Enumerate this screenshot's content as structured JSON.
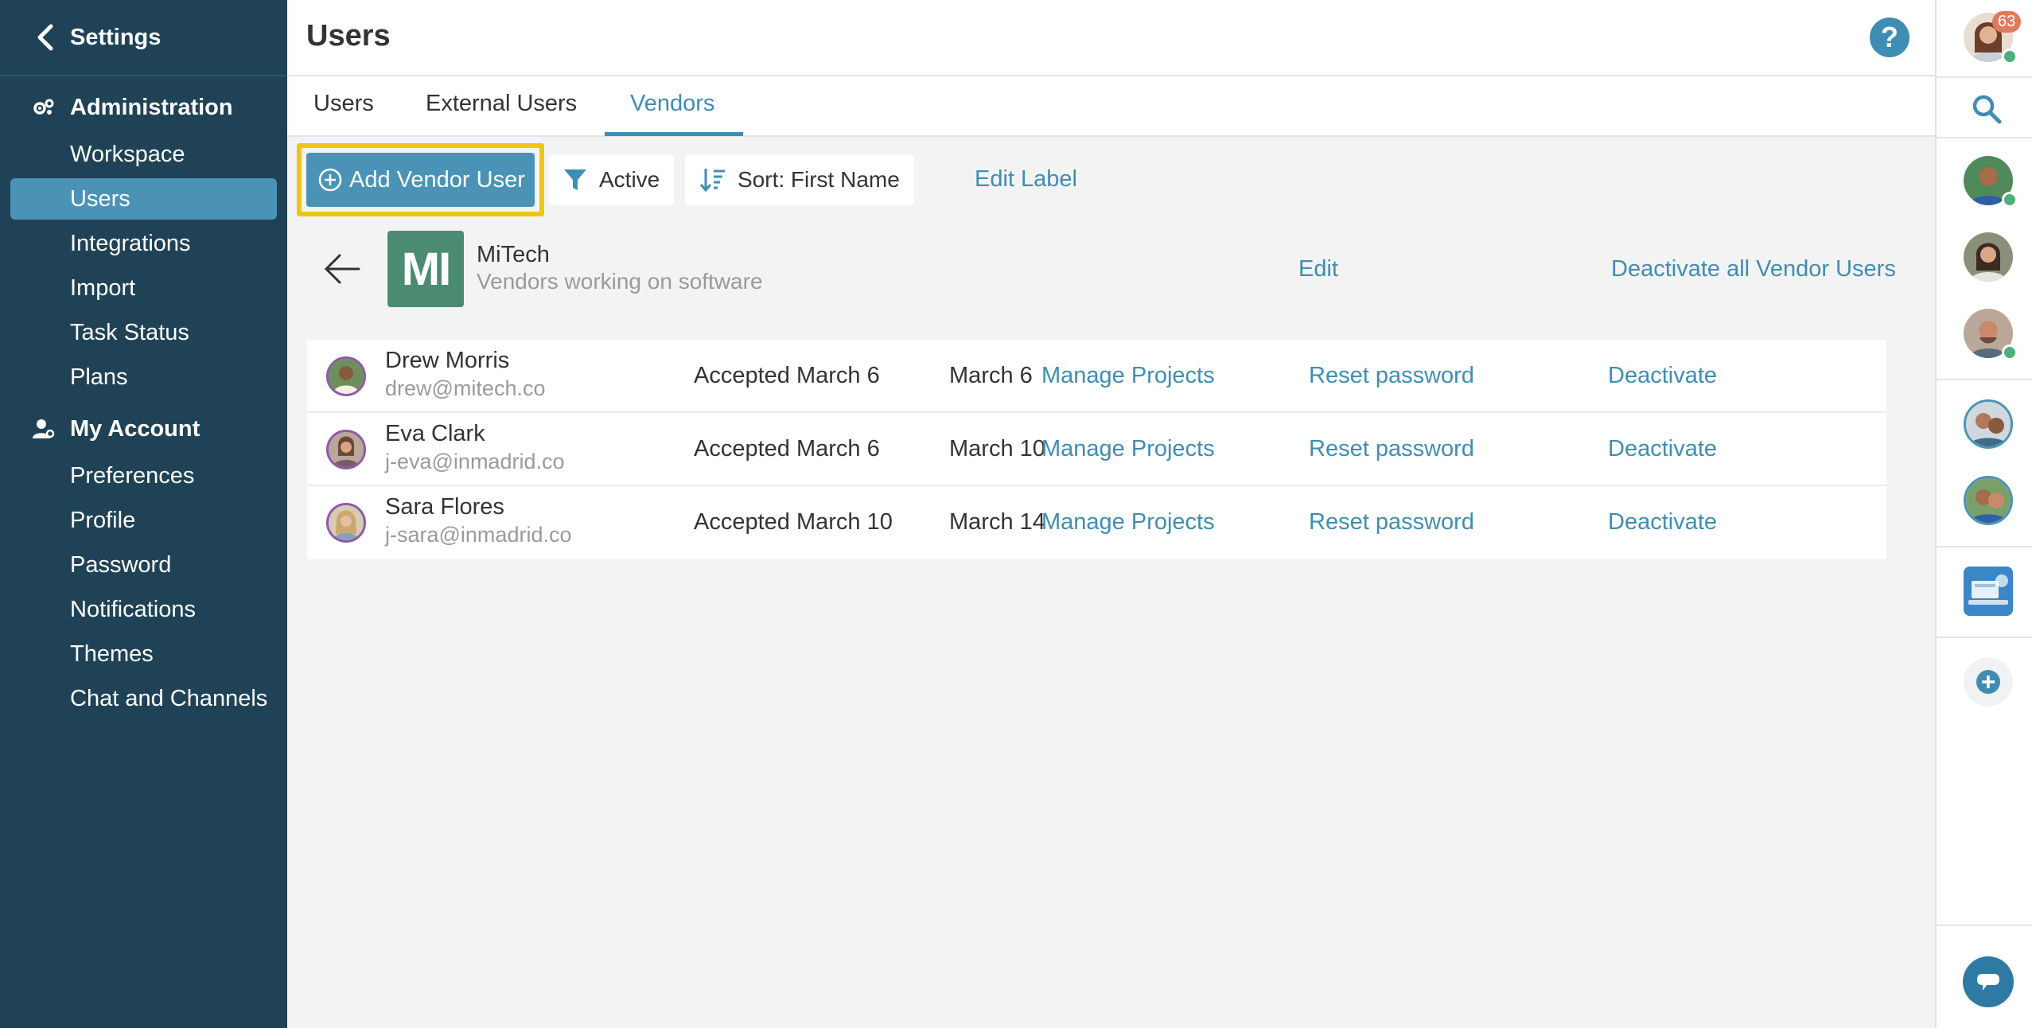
{
  "sidebar": {
    "back_label": "Settings",
    "sections": [
      {
        "label": "Administration",
        "icon": "gears-icon"
      },
      {
        "label": "My Account",
        "icon": "user-gear-icon"
      }
    ],
    "admin_items": [
      "Workspace",
      "Users",
      "Integrations",
      "Import",
      "Task Status",
      "Plans"
    ],
    "account_items": [
      "Preferences",
      "Profile",
      "Password",
      "Notifications",
      "Themes",
      "Chat and Channels"
    ],
    "active_item": "Users"
  },
  "header": {
    "title": "Users",
    "help_icon": "?"
  },
  "tabs": [
    {
      "label": "Users"
    },
    {
      "label": "External Users"
    },
    {
      "label": "Vendors",
      "active": true
    }
  ],
  "toolbar": {
    "add_label": "Add Vendor User",
    "filter_label": "Active",
    "sort_label": "Sort: First Name",
    "edit_label": "Edit Label"
  },
  "vendor": {
    "logo_text": "MI",
    "name": "MiTech",
    "description": "Vendors working on software",
    "edit_label": "Edit",
    "deactivate_all_label": "Deactivate all Vendor Users"
  },
  "users": [
    {
      "name": "Drew Morris",
      "email": "drew@mitech.co",
      "status": "Accepted March 6",
      "date": "March 6",
      "manage": "Manage Projects",
      "reset": "Reset password",
      "deactivate": "Deactivate"
    },
    {
      "name": "Eva Clark",
      "email": "j-eva@inmadrid.co",
      "status": "Accepted March 6",
      "date": "March 10",
      "manage": "Manage Projects",
      "reset": "Reset password",
      "deactivate": "Deactivate"
    },
    {
      "name": "Sara Flores",
      "email": "j-sara@inmadrid.co",
      "status": "Accepted March 10",
      "date": "March 14",
      "manage": "Manage Projects",
      "reset": "Reset password",
      "deactivate": "Deactivate"
    }
  ],
  "rail": {
    "notification_count": "63"
  },
  "colors": {
    "sidebar": "#1f4256",
    "accent": "#3f8db3",
    "active_item": "#4a93b7",
    "highlight": "#f0c419",
    "vendor_logo": "#4b8b72"
  }
}
